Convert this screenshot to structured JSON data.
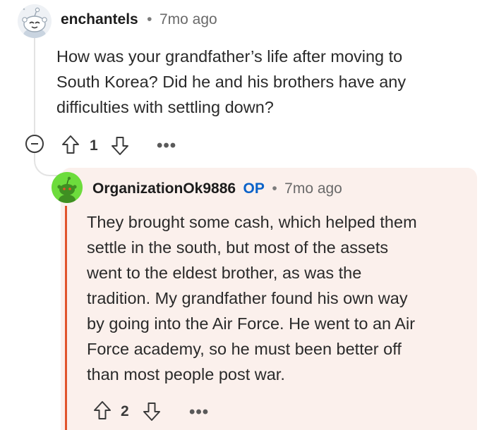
{
  "parent_comment": {
    "username": "enchantels",
    "separator": "•",
    "time": "7mo ago",
    "lines": [
      "How was your grandfather’s life after moving to",
      "South Korea? Did he and his brothers have any",
      "difficulties with settling down?"
    ],
    "vote_count": "1",
    "more": "•••"
  },
  "reply_comment": {
    "username": "OrganizationOk9886",
    "op_badge": "OP",
    "separator": "•",
    "time": "7mo ago",
    "lines": [
      "They brought some cash, which helped them",
      "settle in the south, but most of the assets",
      "went to the eldest brother, as was the",
      "tradition. My grandfather found his own way",
      "by going into the Air Force. He went to an Air",
      "Force academy, so he must been better off",
      "than most people post war."
    ],
    "vote_count": "2",
    "more": "•••"
  },
  "icons": [
    "avatar",
    "collapse-icon",
    "upvote-icon",
    "downvote-icon",
    "more-icon"
  ],
  "colors": {
    "op": "#0a62c9",
    "highlight_bg": "#fbf0ec",
    "highlight_bar": "#e1542c",
    "avatar2": "#6ddc3c"
  }
}
